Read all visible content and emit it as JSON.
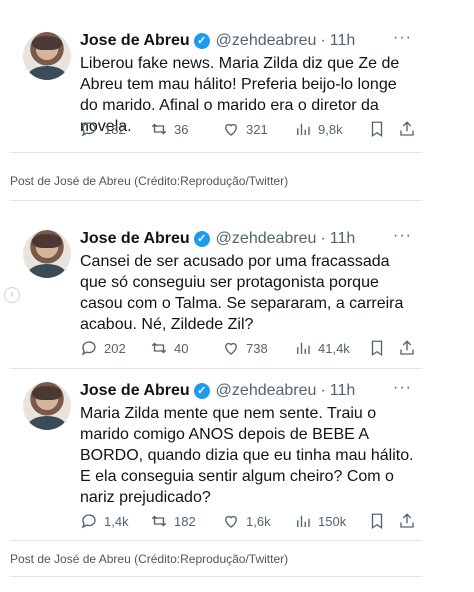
{
  "tweets": [
    {
      "name": "Jose de Abreu",
      "handle": "@zehdeabreu",
      "time": "11h",
      "more": "···",
      "text": "Liberou fake news. Maria Zilda diz que Ze de Abreu tem mau hálito! Preferia beijo-lo longe do marido. Afinal o marido era o diretor da novela.",
      "replies": "182",
      "retweets": "36",
      "likes": "321",
      "views": "9,8k"
    },
    {
      "name": "Jose de Abreu",
      "handle": "@zehdeabreu",
      "time": "11h",
      "more": "···",
      "text": "Cansei de ser acusado por uma fracassada que só conseguiu ser protagonista porque casou com o Talma. Se separaram, a carreira acabou. Né, Zildede Zil?",
      "replies": "202",
      "retweets": "40",
      "likes": "738",
      "views": "41,4k"
    },
    {
      "name": "Jose de Abreu",
      "handle": "@zehdeabreu",
      "time": "11h",
      "more": "···",
      "text": "Maria Zilda mente que nem sente. Traiu o marido comigo ANOS depois de BEBE A BORDO, quando dizia que eu tinha mau hálito. E ela conseguia sentir algum cheiro? Com o nariz prejudicado?",
      "replies": "1,4k",
      "retweets": "182",
      "likes": "1,6k",
      "views": "150k"
    }
  ],
  "credits": [
    "Post de José de Abreu (Crédito:Reprodução/Twitter)",
    "Post de José de Abreu (Crédito:Reprodução/Twitter)"
  ],
  "icons": {
    "verified": "✓",
    "prev": "‹"
  }
}
